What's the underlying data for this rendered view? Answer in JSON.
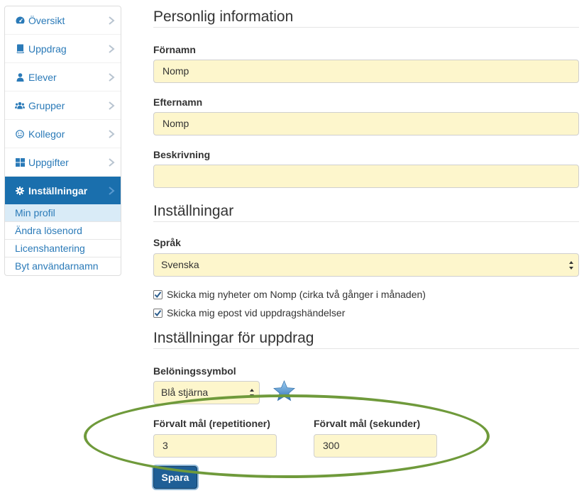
{
  "sidebar": {
    "items": [
      {
        "label": "Översikt",
        "icon": "dashboard-icon"
      },
      {
        "label": "Uppdrag",
        "icon": "book-icon"
      },
      {
        "label": "Elever",
        "icon": "user-icon"
      },
      {
        "label": "Grupper",
        "icon": "users-icon"
      },
      {
        "label": "Kollegor",
        "icon": "smile-icon"
      },
      {
        "label": "Uppgifter",
        "icon": "grid-icon"
      },
      {
        "label": "Inställningar",
        "icon": "gear-icon"
      }
    ],
    "subitems": [
      "Min profil",
      "Ändra lösenord",
      "Licenshantering",
      "Byt användarnamn"
    ]
  },
  "personal": {
    "title": "Personlig information",
    "firstname_label": "Förnamn",
    "firstname_value": "Nomp",
    "lastname_label": "Efternamn",
    "lastname_value": "Nomp",
    "description_label": "Beskrivning",
    "description_value": ""
  },
  "settings": {
    "title": "Inställningar",
    "language_label": "Språk",
    "language_value": "Svenska",
    "check1": "Skicka mig nyheter om Nomp (cirka två gånger i månaden)",
    "check2": "Skicka mig epost vid uppdragshändelser"
  },
  "assignment": {
    "title": "Inställningar för uppdrag",
    "reward_label": "Belöningssymbol",
    "reward_value": "Blå stjärna",
    "reps_label": "Förvalt mål (repetitioner)",
    "reps_value": "3",
    "secs_label": "Förvalt mål (sekunder)",
    "secs_value": "300"
  },
  "save_label": "Spara",
  "colors": {
    "accent": "#1a6fad",
    "input_bg": "#fdf6cc",
    "highlight_ellipse": "#6f9a3b",
    "star": "#4a8fd0"
  }
}
